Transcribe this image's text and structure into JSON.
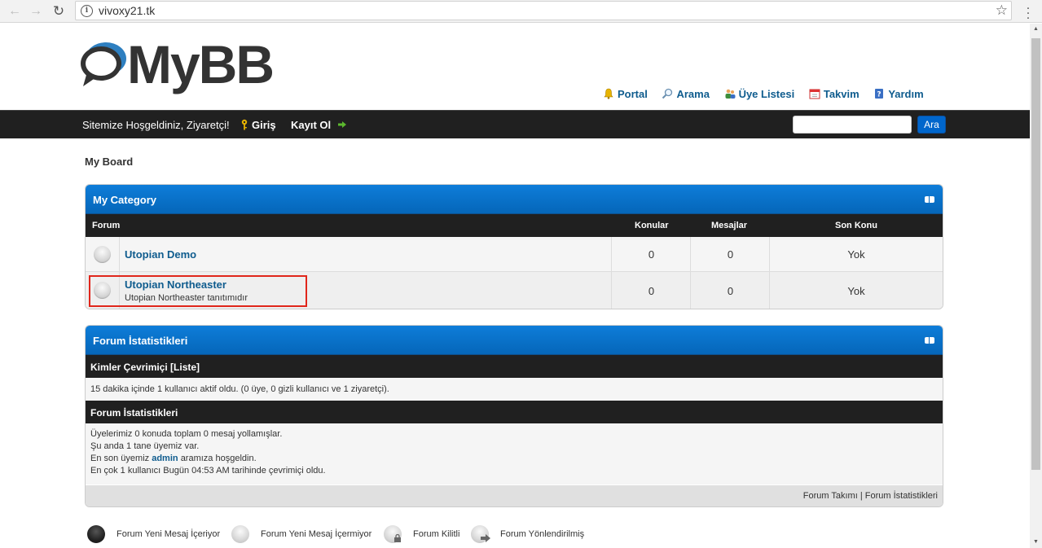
{
  "browser": {
    "url": "vivoxy21.tk"
  },
  "header": {
    "logo_text": "MyBB",
    "toplinks": [
      "Portal",
      "Arama",
      "Üye Listesi",
      "Takvim",
      "Yardım"
    ]
  },
  "panel": {
    "welcome": "Sitemize Hoşgeldiniz, Ziyaretçi!",
    "login": "Giriş",
    "register": "Kayıt Ol",
    "search_button": "Ara",
    "search_value": ""
  },
  "breadcrumb": "My Board",
  "category": {
    "title": "My Category",
    "columns": [
      "Forum",
      "Konular",
      "Mesajlar",
      "Son Konu"
    ],
    "forums": [
      {
        "name": "Utopian Demo",
        "description": "",
        "threads": "0",
        "posts": "0",
        "last_post": "Yok"
      },
      {
        "name": "Utopian Northeaster",
        "description": "Utopian Northeaster tanıtımıdır",
        "threads": "0",
        "posts": "0",
        "last_post": "Yok"
      }
    ]
  },
  "stats": {
    "title": "Forum İstatistikleri",
    "online_header": "Kimler Çevrimiçi [Liste]",
    "online_text": "15 dakika içinde 1 kullanıcı aktif oldu. (0 üye, 0 gizli kullanıcı ve 1 ziyaretçi).",
    "stats_header": "Forum İstatistikleri",
    "line1": "Üyelerimiz 0 konuda toplam 0 mesaj yollamışlar.",
    "line2": "Şu anda 1 tane üyemiz var.",
    "line3_pre": "En son üyemiz",
    "line3_user": "admin",
    "line3_post": "aramıza hoşgeldin.",
    "line4": "En çok 1 kullanıcı Bugün 04:53 AM tarihinde çevrimiçi oldu.",
    "footer_team": "Forum Takımı",
    "footer_sep": "|",
    "footer_stats": "Forum İstatistikleri"
  },
  "legend": [
    "Forum Yeni Mesaj İçeriyor",
    "Forum Yeni Mesaj İçermiyor",
    "Forum Kilitli",
    "Forum Yönlendirilmiş"
  ]
}
